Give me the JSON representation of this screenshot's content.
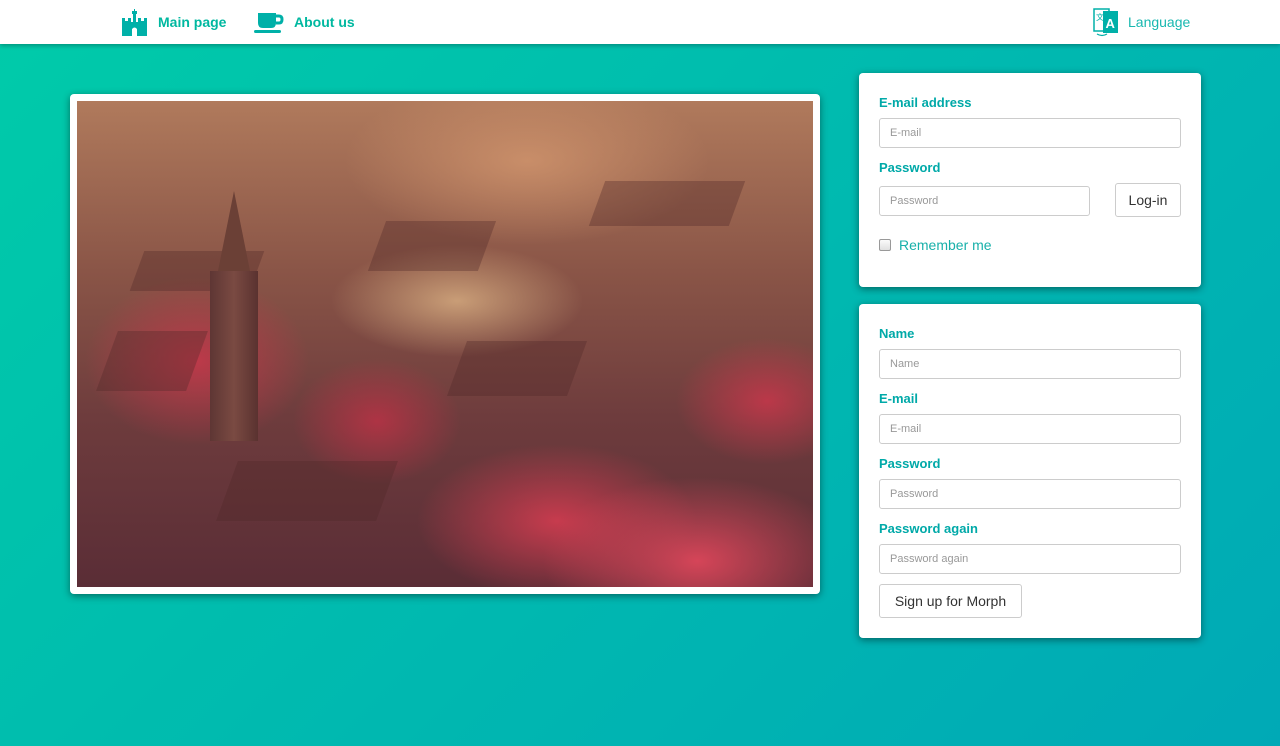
{
  "nav": {
    "main_label": "Main page",
    "about_label": "About us",
    "language_label": "Language"
  },
  "login": {
    "email_label": "E-mail address",
    "email_placeholder": "E-mail",
    "password_label": "Password",
    "password_placeholder": "Password",
    "login_button": "Log-in",
    "remember_label": "Remember me"
  },
  "signup": {
    "name_label": "Name",
    "name_placeholder": "Name",
    "email_label": "E-mail",
    "email_placeholder": "E-mail",
    "password_label": "Password",
    "password_placeholder": "Password",
    "password_again_label": "Password again",
    "password_again_placeholder": "Password again",
    "submit_button": "Sign up for Morph"
  },
  "colors": {
    "accent": "#00b8a0",
    "label": "#00a9a8",
    "background_start": "#00cba9",
    "background_end": "#00a9b6"
  },
  "icons": {
    "main": "castle-icon",
    "about": "coffee-cup-icon",
    "language": "translate-icon"
  }
}
